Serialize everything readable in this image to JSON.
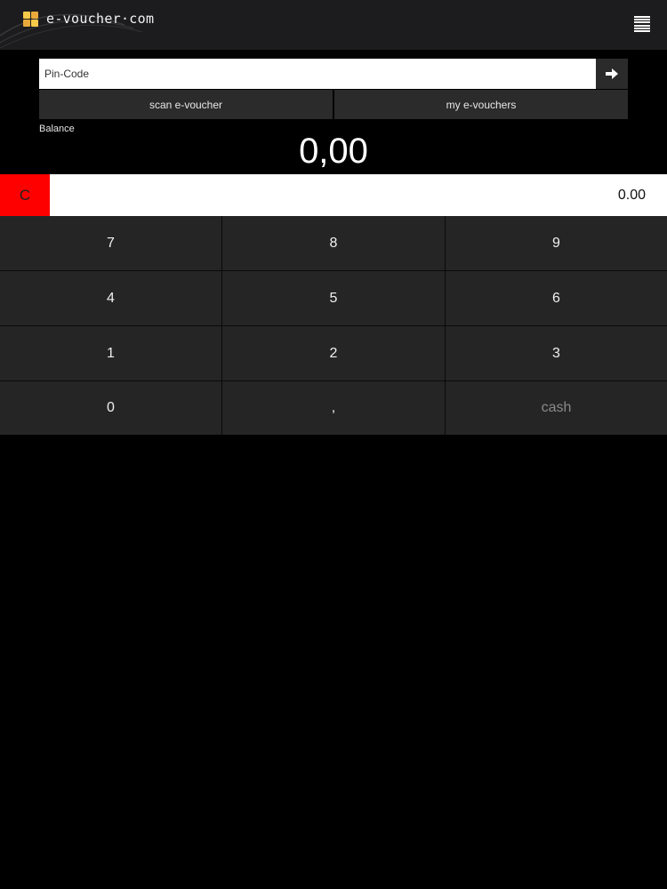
{
  "header": {
    "logo_text": "e-voucher·com",
    "menu_icon": "menu-icon"
  },
  "pin": {
    "placeholder": "Pin-Code",
    "value": "",
    "submit_icon": "arrow-right-icon"
  },
  "actions": {
    "scan_label": "scan e-voucher",
    "mine_label": "my e-vouchers"
  },
  "balance": {
    "label": "Balance",
    "value": "0,00"
  },
  "amount": {
    "clear_label": "C",
    "value": "0.00"
  },
  "keypad": {
    "keys": [
      "7",
      "8",
      "9",
      "4",
      "5",
      "6",
      "1",
      "2",
      "3",
      "0",
      ",",
      "cash"
    ]
  },
  "colors": {
    "clear_button": "#ff0000",
    "header_bg": "#1c1c1e",
    "key_bg": "#252525"
  }
}
